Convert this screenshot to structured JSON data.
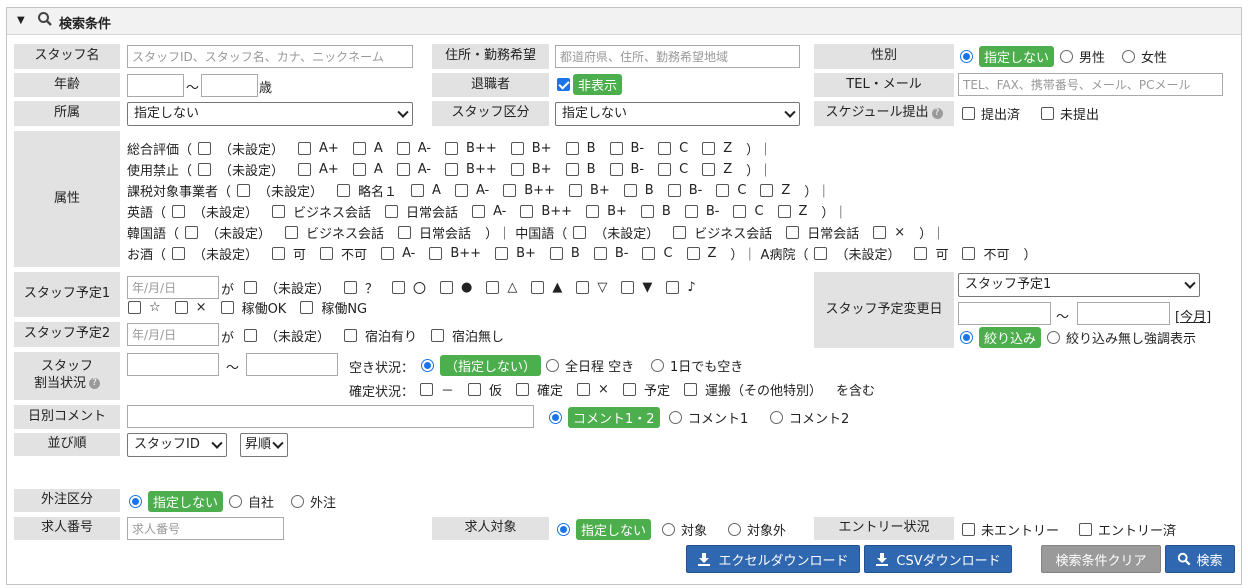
{
  "header": {
    "title": "検索条件"
  },
  "row1": {
    "staff_name_label": "スタッフ名",
    "staff_name_placeholder": "スタッフID、スタッフ名、カナ、ニックネーム",
    "address_label": "住所・勤務希望",
    "address_placeholder": "都道府県、住所、勤務希望地域",
    "gender_label": "性別",
    "gender_options": [
      "指定しない",
      "男性",
      "女性"
    ]
  },
  "row2": {
    "age_label": "年齢",
    "age_sep": "〜",
    "age_unit": "歳",
    "retired_label": "退職者",
    "retired_option": "非表示",
    "tel_label": "TEL・メール",
    "tel_placeholder": "TEL、FAX、携帯番号、メール、PCメール"
  },
  "row3": {
    "affiliation_label": "所属",
    "affiliation_value": "指定しない",
    "staff_kubun_label": "スタッフ区分",
    "staff_kubun_value": "指定しない",
    "schedule_label": "スケジュール提出",
    "schedule_options": [
      "提出済",
      "未提出"
    ]
  },
  "attributes": {
    "label": "属性",
    "lines": [
      [
        {
          "t": "総合評価（"
        },
        {
          "c": "（未設定）"
        },
        {
          "c": "A+"
        },
        {
          "c": "A"
        },
        {
          "c": "A-"
        },
        {
          "c": "B++"
        },
        {
          "c": "B+"
        },
        {
          "c": "B"
        },
        {
          "c": "B-"
        },
        {
          "c": "C"
        },
        {
          "c": "Z"
        },
        {
          "t": "）｜"
        }
      ],
      [
        {
          "t": "使用禁止（"
        },
        {
          "c": "（未設定）"
        },
        {
          "c": "A+"
        },
        {
          "c": "A"
        },
        {
          "c": "A-"
        },
        {
          "c": "B++"
        },
        {
          "c": "B+"
        },
        {
          "c": "B"
        },
        {
          "c": "B-"
        },
        {
          "c": "C"
        },
        {
          "c": "Z"
        },
        {
          "t": "）｜"
        }
      ],
      [
        {
          "t": "課税対象事業者（"
        },
        {
          "c": "（未設定）"
        },
        {
          "c": "略名１"
        },
        {
          "c": "A"
        },
        {
          "c": "A-"
        },
        {
          "c": "B++"
        },
        {
          "c": "B+"
        },
        {
          "c": "B"
        },
        {
          "c": "B-"
        },
        {
          "c": "C"
        },
        {
          "c": "Z"
        },
        {
          "t": "）｜"
        }
      ],
      [
        {
          "t": "英語（"
        },
        {
          "c": "（未設定）"
        },
        {
          "c": "ビジネス会話"
        },
        {
          "c": "日常会話"
        },
        {
          "c": "A-"
        },
        {
          "c": "B++"
        },
        {
          "c": "B+"
        },
        {
          "c": "B"
        },
        {
          "c": "B-"
        },
        {
          "c": "C"
        },
        {
          "c": "Z"
        },
        {
          "t": "）｜"
        }
      ],
      [
        {
          "t": "韓国語（"
        },
        {
          "c": "（未設定）"
        },
        {
          "c": "ビジネス会話"
        },
        {
          "c": "日常会話"
        },
        {
          "t": "）｜ 中国語（"
        },
        {
          "c": "（未設定）"
        },
        {
          "c": "ビジネス会話"
        },
        {
          "c": "日常会話"
        },
        {
          "c": "×"
        },
        {
          "t": "）｜"
        }
      ],
      [
        {
          "t": "お酒（"
        },
        {
          "c": "（未設定）"
        },
        {
          "c": "可"
        },
        {
          "c": "不可"
        },
        {
          "c": "A-"
        },
        {
          "c": "B++"
        },
        {
          "c": "B+"
        },
        {
          "c": "B"
        },
        {
          "c": "B-"
        },
        {
          "c": "C"
        },
        {
          "c": "Z"
        },
        {
          "t": "）｜ A病院（"
        },
        {
          "c": "（未設定）"
        },
        {
          "c": "可"
        },
        {
          "c": "不可"
        },
        {
          "t": "）"
        }
      ]
    ]
  },
  "staff_plan1": {
    "label": "スタッフ予定1",
    "date_placeholder": "年/月/日",
    "ga": "が",
    "line1": [
      "（未設定）",
      "？",
      "〇",
      "●",
      "△",
      "▲",
      "▽",
      "▼",
      "♪"
    ],
    "line2": [
      "☆",
      "×",
      "稼働OK",
      "稼働NG"
    ]
  },
  "staff_plan2": {
    "label": "スタッフ予定2",
    "date_placeholder": "年/月/日",
    "ga": "が",
    "options": [
      "（未設定）",
      "宿泊有り",
      "宿泊無し"
    ]
  },
  "plan_change": {
    "label": "スタッフ予定変更日",
    "select_value": "スタッフ予定1",
    "sep": "〜",
    "today_link": "[今月]",
    "options": [
      "絞り込み",
      "絞り込み無し強調表示"
    ]
  },
  "assign": {
    "label_line1": "スタッフ",
    "label_line2": "割当状況",
    "sep": "〜",
    "vacancy_label": "空き状況：",
    "vacancy_options": [
      "（指定しない）",
      "全日程 空き",
      "1日でも空き"
    ],
    "confirm_label": "確定状況：",
    "confirm_options": [
      "－",
      "仮",
      "確定",
      "×",
      "予定",
      "運搬（その他特別）"
    ],
    "confirm_suffix": "を含む"
  },
  "daily_comment": {
    "label": "日別コメント",
    "options": [
      "コメント1・2",
      "コメント1",
      "コメント2"
    ]
  },
  "order": {
    "label": "並び順",
    "sort_field": "スタッフID",
    "sort_dir": "昇順"
  },
  "outsource": {
    "label": "外注区分",
    "options": [
      "指定しない",
      "自社",
      "外注"
    ]
  },
  "job_number": {
    "label": "求人番号",
    "placeholder": "求人番号"
  },
  "job_target": {
    "label": "求人対象",
    "options": [
      "指定しない",
      "対象",
      "対象外"
    ]
  },
  "entry": {
    "label": "エントリー状況",
    "options": [
      "未エントリー",
      "エントリー済"
    ]
  },
  "buttons": {
    "excel": "エクセルダウンロード",
    "csv": "CSVダウンロード",
    "clear": "検索条件クリア",
    "search": "検索"
  },
  "colors": {
    "accent": "#1a73e8",
    "pill": "#4cae4c",
    "button": "#2f67b1",
    "label_bg": "#e2e2e2"
  }
}
